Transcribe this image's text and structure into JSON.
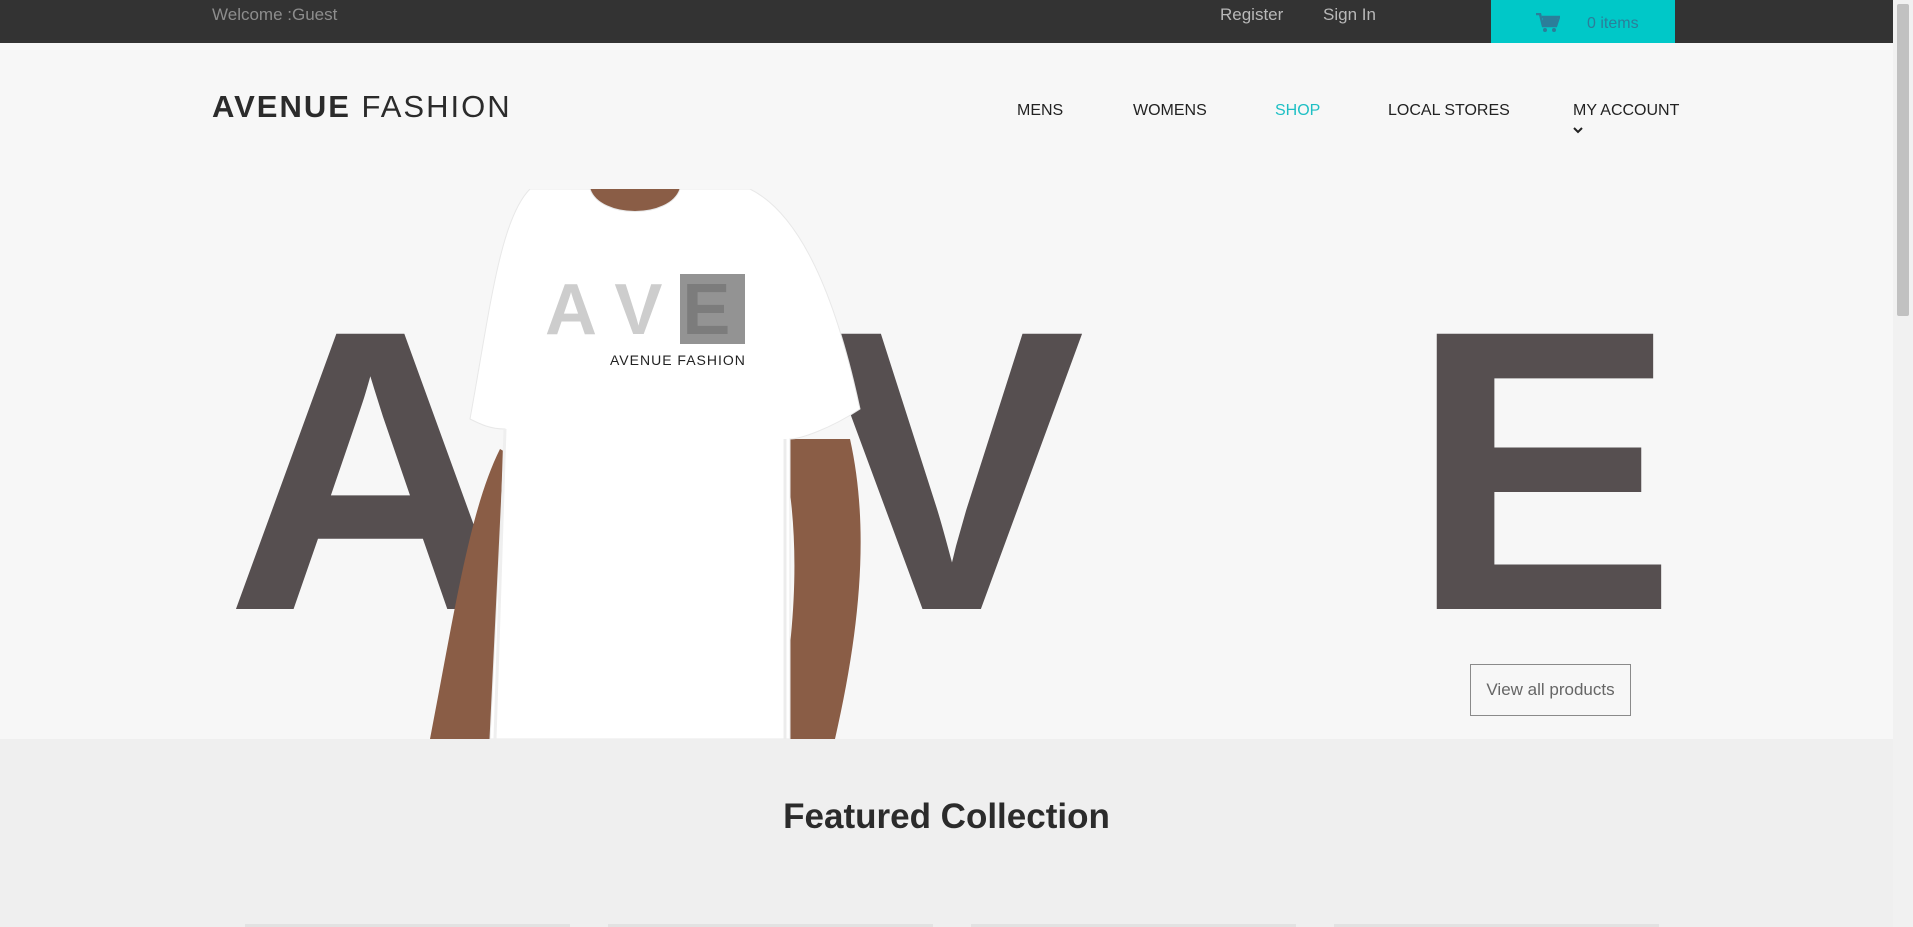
{
  "topbar": {
    "welcome": "Welcome :Guest",
    "register": "Register",
    "signin": "Sign In",
    "cart_label": "0 items"
  },
  "header": {
    "logo_bold": "AVENUE",
    "logo_light": "FASHION",
    "nav": [
      "MENS",
      "WOMENS",
      "SHOP",
      "LOCAL STORES",
      "MY ACCOUNT"
    ],
    "active_nav": "SHOP"
  },
  "hero": {
    "letters": [
      "A",
      "V",
      "E"
    ],
    "shirt_print": "AVENUE FASHION",
    "shirt_letters": "A V E",
    "button_label": "View all products"
  },
  "featured": {
    "title": "Featured Collection"
  },
  "colors": {
    "topbar": "#333333",
    "accent": "#00c8c8",
    "active_nav": "#1ebfc4",
    "hero_letters": "#564f50"
  }
}
